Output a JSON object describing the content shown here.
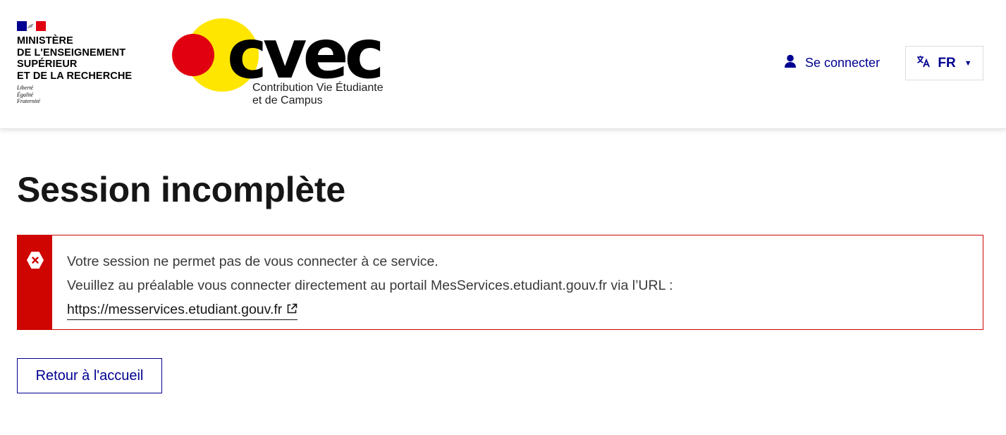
{
  "header": {
    "ministry_lines": [
      "MINISTÈRE",
      "DE L'ENSEIGNEMENT",
      "SUPÉRIEUR",
      "ET DE LA RECHERCHE"
    ],
    "devise_lines": [
      "Liberté",
      "Égalité",
      "Fraternité"
    ],
    "flag_colors": [
      "#000091",
      "#ffffff",
      "#e1000f"
    ],
    "logo": {
      "wordmark": "cvec",
      "subtitle_lines": [
        "Contribution Vie Étudiante",
        "et de Campus"
      ],
      "yellow": "#ffe600",
      "red": "#e1000f"
    },
    "login": {
      "label": "Se connecter",
      "icon": "user-icon"
    },
    "language": {
      "selected": "FR",
      "icon": "translate-icon"
    }
  },
  "main": {
    "title": "Session incomplète",
    "alert": {
      "type": "error",
      "icon": "error-icon",
      "color": "#ce0500",
      "line1": "Votre session ne permet pas de vous connecter à ce service.",
      "line2": "Veuillez au préalable vous connecter directement au portail MesServices.etudiant.gouv.fr via l’URL :",
      "link_text": "https://messervices.etudiant.gouv.fr"
    },
    "home_button": "Retour à l'accueil"
  },
  "colors": {
    "primary": "#000091",
    "error": "#ce0500",
    "text": "#161616"
  }
}
